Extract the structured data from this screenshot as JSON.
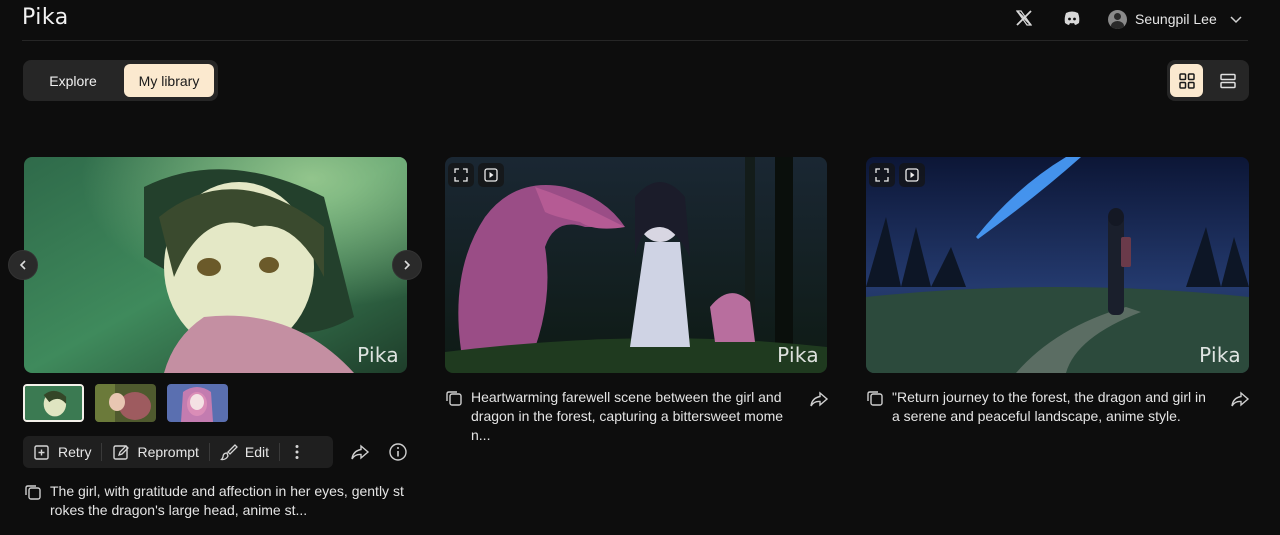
{
  "header": {
    "logo": "Pika",
    "icons": [
      "x-icon",
      "discord-icon"
    ],
    "user_name": "Seungpil Lee"
  },
  "tabs": {
    "explore": "Explore",
    "my_library": "My library",
    "active": "My library"
  },
  "view_toggle": {
    "active": "grid"
  },
  "cards": [
    {
      "watermark": "Pika",
      "caption": "The girl, with gratitude and affection in her eyes, gently st rokes the dragon's large head, anime st...",
      "thumbnails": 3,
      "actions": {
        "retry": "Retry",
        "reprompt": "Reprompt",
        "edit": "Edit"
      }
    },
    {
      "watermark": "Pika",
      "caption": "Heartwarming farewell scene between the girl and dragon in the forest, capturing a bittersweet mome n..."
    },
    {
      "watermark": "Pika",
      "caption": "\"Return journey to the forest, the dragon and girl in a serene and peaceful landscape, anime style."
    }
  ],
  "colors": {
    "background": "#0d0d0d",
    "accent": "#fbe9cf",
    "panel": "#262626"
  }
}
